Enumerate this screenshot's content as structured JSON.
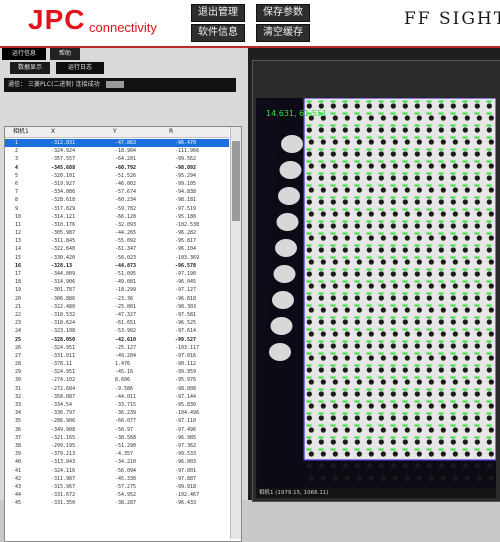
{
  "header": {
    "logo_main": "JPC",
    "logo_sub": "connectivity",
    "buttons": [
      "退出管理",
      "保存参数",
      "软件信息",
      "清空缓存"
    ],
    "system_title": "FF SIGHT"
  },
  "left_panel": {
    "tabs": [
      "运行信息",
      "帮助"
    ],
    "subtabs": [
      "数据显示",
      "运行日志"
    ],
    "info_label": "通信：",
    "info_text": "三菱PLC(二进制)  连接成功",
    "table": {
      "columns": [
        "相机1",
        "X",
        "Y",
        "R"
      ],
      "rows": [
        {
          "id": "1",
          "x": "-312.031",
          "y": "-47.863",
          "r": "-96.470"
        },
        {
          "id": "2",
          "x": "-324.924",
          "y": "-18.904",
          "r": "-111.966"
        },
        {
          "id": "3",
          "x": "-357.557",
          "y": "-64.201",
          "r": "-99.562"
        },
        {
          "id": "4",
          "x": "-345.688",
          "y": "-60.792",
          "r": "-98.092"
        },
        {
          "id": "5",
          "x": "-320.101",
          "y": "-51.526",
          "r": "-95.294"
        },
        {
          "id": "6",
          "x": "-319.927",
          "y": "-46.002",
          "r": "-99.105"
        },
        {
          "id": "7",
          "x": "-334.086",
          "y": "-57.674",
          "r": "-94.838"
        },
        {
          "id": "8",
          "x": "-328.618",
          "y": "-60.234",
          "r": "-98.181"
        },
        {
          "id": "9",
          "x": "-317.029",
          "y": "-59.782",
          "r": "-97.519"
        },
        {
          "id": "10",
          "x": "-314.121",
          "y": "-66.120",
          "r": "-95.180"
        },
        {
          "id": "11",
          "x": "-310.176",
          "y": "-32.093",
          "r": "-102.538"
        },
        {
          "id": "12",
          "x": "-305.987",
          "y": "-44.265",
          "r": "-96.282"
        },
        {
          "id": "13",
          "x": "-311.845",
          "y": "-55.092",
          "r": "-95.817"
        },
        {
          "id": "14",
          "x": "-322.640",
          "y": "-61.347",
          "r": "-96.104"
        },
        {
          "id": "15",
          "x": "-330.420",
          "y": "-56.023",
          "r": "-103.369"
        },
        {
          "id": "16",
          "x": "-328.13",
          "y": "-44.873",
          "r": "-96.578"
        },
        {
          "id": "17",
          "x": "-344.009",
          "y": "-51.095",
          "r": "-97.190"
        },
        {
          "id": "18",
          "x": "-314.906",
          "y": "-49.081",
          "r": "-96.045"
        },
        {
          "id": "19",
          "x": "-301.787",
          "y": "-18.299",
          "r": "-97.127"
        },
        {
          "id": "20",
          "x": "-306.886",
          "y": "-23.36",
          "r": "-96.818"
        },
        {
          "id": "21",
          "x": "-322.480",
          "y": "-25.001",
          "r": "-98.303"
        },
        {
          "id": "22",
          "x": "-318.532",
          "y": "-47.327",
          "r": "-97.581"
        },
        {
          "id": "23",
          "x": "-318.624",
          "y": "-61.651",
          "r": "-96.525"
        },
        {
          "id": "24",
          "x": "-323.108",
          "y": "-53.902",
          "r": "-97.614"
        },
        {
          "id": "25",
          "x": "-328.050",
          "y": "-42.610",
          "r": "-99.527"
        },
        {
          "id": "26",
          "x": "-324.951",
          "y": "-25.127",
          "r": "-103.117"
        },
        {
          "id": "27",
          "x": "-331.011",
          "y": "-49.204",
          "r": "-97.016"
        },
        {
          "id": "28",
          "x": "-378.11",
          "y": "1.476",
          "r": "-90.112"
        },
        {
          "id": "29",
          "x": "-324.951",
          "y": "-45.16",
          "r": "-99.959"
        },
        {
          "id": "30",
          "x": "-274.102",
          "y": "8.606",
          "r": "-95.976"
        },
        {
          "id": "31",
          "x": "-272.684",
          "y": "-9.586",
          "r": "-98.008"
        },
        {
          "id": "32",
          "x": "-358.087",
          "y": "-44.011",
          "r": "-97.144"
        },
        {
          "id": "33",
          "x": "-334.54",
          "y": "-33.715",
          "r": "-95.830"
        },
        {
          "id": "34",
          "x": "-336.797",
          "y": "-36.239",
          "r": "-104.496"
        },
        {
          "id": "35",
          "x": "-286.906",
          "y": "-66.077",
          "r": "-97.110"
        },
        {
          "id": "36",
          "x": "-349.908",
          "y": "-56.97",
          "r": "-97.496"
        },
        {
          "id": "37",
          "x": "-321.165",
          "y": "-38.568",
          "r": "-96.985"
        },
        {
          "id": "38",
          "x": "-299.195",
          "y": "-51.290",
          "r": "-97.362"
        },
        {
          "id": "39",
          "x": "-379.213",
          "y": "-4.357",
          "r": "-99.533"
        },
        {
          "id": "40",
          "x": "-313.043",
          "y": "-34.210",
          "r": "-96.003"
        },
        {
          "id": "41",
          "x": "-324.116",
          "y": "-56.094",
          "r": "-97.001"
        },
        {
          "id": "42",
          "x": "-311.987",
          "y": "-45.330",
          "r": "-97.887"
        },
        {
          "id": "43",
          "x": "-315.967",
          "y": "-57.275",
          "r": "-99.918"
        },
        {
          "id": "44",
          "x": "-331.672",
          "y": "-54.952",
          "r": "-102.467"
        },
        {
          "id": "45",
          "x": "-331.350",
          "y": "-38.287",
          "r": "-96.433"
        }
      ]
    }
  },
  "camera": {
    "overlay_text": "14.631, 61.551",
    "status_text": "相机1   (1979.15, 1066.11)",
    "colors": {
      "rect": "#4b3bd6",
      "mark": "#33e23a",
      "background": "#0d0d1a"
    }
  }
}
